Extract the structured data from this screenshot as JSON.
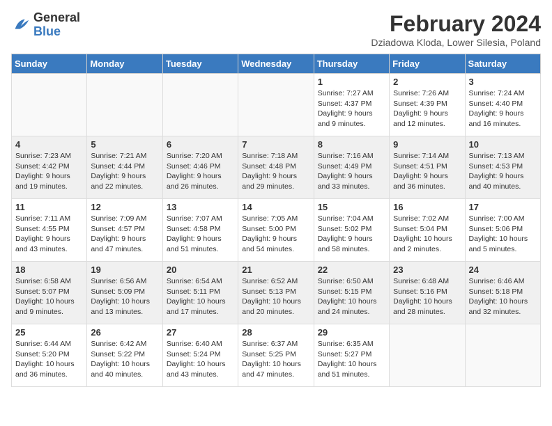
{
  "header": {
    "logo": {
      "line1": "General",
      "line2": "Blue"
    },
    "month_year": "February 2024",
    "location": "Dziadowa Kloda, Lower Silesia, Poland"
  },
  "weekdays": [
    "Sunday",
    "Monday",
    "Tuesday",
    "Wednesday",
    "Thursday",
    "Friday",
    "Saturday"
  ],
  "weeks": [
    [
      {
        "day": "",
        "info": ""
      },
      {
        "day": "",
        "info": ""
      },
      {
        "day": "",
        "info": ""
      },
      {
        "day": "",
        "info": ""
      },
      {
        "day": "1",
        "info": "Sunrise: 7:27 AM\nSunset: 4:37 PM\nDaylight: 9 hours\nand 9 minutes."
      },
      {
        "day": "2",
        "info": "Sunrise: 7:26 AM\nSunset: 4:39 PM\nDaylight: 9 hours\nand 12 minutes."
      },
      {
        "day": "3",
        "info": "Sunrise: 7:24 AM\nSunset: 4:40 PM\nDaylight: 9 hours\nand 16 minutes."
      }
    ],
    [
      {
        "day": "4",
        "info": "Sunrise: 7:23 AM\nSunset: 4:42 PM\nDaylight: 9 hours\nand 19 minutes."
      },
      {
        "day": "5",
        "info": "Sunrise: 7:21 AM\nSunset: 4:44 PM\nDaylight: 9 hours\nand 22 minutes."
      },
      {
        "day": "6",
        "info": "Sunrise: 7:20 AM\nSunset: 4:46 PM\nDaylight: 9 hours\nand 26 minutes."
      },
      {
        "day": "7",
        "info": "Sunrise: 7:18 AM\nSunset: 4:48 PM\nDaylight: 9 hours\nand 29 minutes."
      },
      {
        "day": "8",
        "info": "Sunrise: 7:16 AM\nSunset: 4:49 PM\nDaylight: 9 hours\nand 33 minutes."
      },
      {
        "day": "9",
        "info": "Sunrise: 7:14 AM\nSunset: 4:51 PM\nDaylight: 9 hours\nand 36 minutes."
      },
      {
        "day": "10",
        "info": "Sunrise: 7:13 AM\nSunset: 4:53 PM\nDaylight: 9 hours\nand 40 minutes."
      }
    ],
    [
      {
        "day": "11",
        "info": "Sunrise: 7:11 AM\nSunset: 4:55 PM\nDaylight: 9 hours\nand 43 minutes."
      },
      {
        "day": "12",
        "info": "Sunrise: 7:09 AM\nSunset: 4:57 PM\nDaylight: 9 hours\nand 47 minutes."
      },
      {
        "day": "13",
        "info": "Sunrise: 7:07 AM\nSunset: 4:58 PM\nDaylight: 9 hours\nand 51 minutes."
      },
      {
        "day": "14",
        "info": "Sunrise: 7:05 AM\nSunset: 5:00 PM\nDaylight: 9 hours\nand 54 minutes."
      },
      {
        "day": "15",
        "info": "Sunrise: 7:04 AM\nSunset: 5:02 PM\nDaylight: 9 hours\nand 58 minutes."
      },
      {
        "day": "16",
        "info": "Sunrise: 7:02 AM\nSunset: 5:04 PM\nDaylight: 10 hours\nand 2 minutes."
      },
      {
        "day": "17",
        "info": "Sunrise: 7:00 AM\nSunset: 5:06 PM\nDaylight: 10 hours\nand 5 minutes."
      }
    ],
    [
      {
        "day": "18",
        "info": "Sunrise: 6:58 AM\nSunset: 5:07 PM\nDaylight: 10 hours\nand 9 minutes."
      },
      {
        "day": "19",
        "info": "Sunrise: 6:56 AM\nSunset: 5:09 PM\nDaylight: 10 hours\nand 13 minutes."
      },
      {
        "day": "20",
        "info": "Sunrise: 6:54 AM\nSunset: 5:11 PM\nDaylight: 10 hours\nand 17 minutes."
      },
      {
        "day": "21",
        "info": "Sunrise: 6:52 AM\nSunset: 5:13 PM\nDaylight: 10 hours\nand 20 minutes."
      },
      {
        "day": "22",
        "info": "Sunrise: 6:50 AM\nSunset: 5:15 PM\nDaylight: 10 hours\nand 24 minutes."
      },
      {
        "day": "23",
        "info": "Sunrise: 6:48 AM\nSunset: 5:16 PM\nDaylight: 10 hours\nand 28 minutes."
      },
      {
        "day": "24",
        "info": "Sunrise: 6:46 AM\nSunset: 5:18 PM\nDaylight: 10 hours\nand 32 minutes."
      }
    ],
    [
      {
        "day": "25",
        "info": "Sunrise: 6:44 AM\nSunset: 5:20 PM\nDaylight: 10 hours\nand 36 minutes."
      },
      {
        "day": "26",
        "info": "Sunrise: 6:42 AM\nSunset: 5:22 PM\nDaylight: 10 hours\nand 40 minutes."
      },
      {
        "day": "27",
        "info": "Sunrise: 6:40 AM\nSunset: 5:24 PM\nDaylight: 10 hours\nand 43 minutes."
      },
      {
        "day": "28",
        "info": "Sunrise: 6:37 AM\nSunset: 5:25 PM\nDaylight: 10 hours\nand 47 minutes."
      },
      {
        "day": "29",
        "info": "Sunrise: 6:35 AM\nSunset: 5:27 PM\nDaylight: 10 hours\nand 51 minutes."
      },
      {
        "day": "",
        "info": ""
      },
      {
        "day": "",
        "info": ""
      }
    ]
  ]
}
